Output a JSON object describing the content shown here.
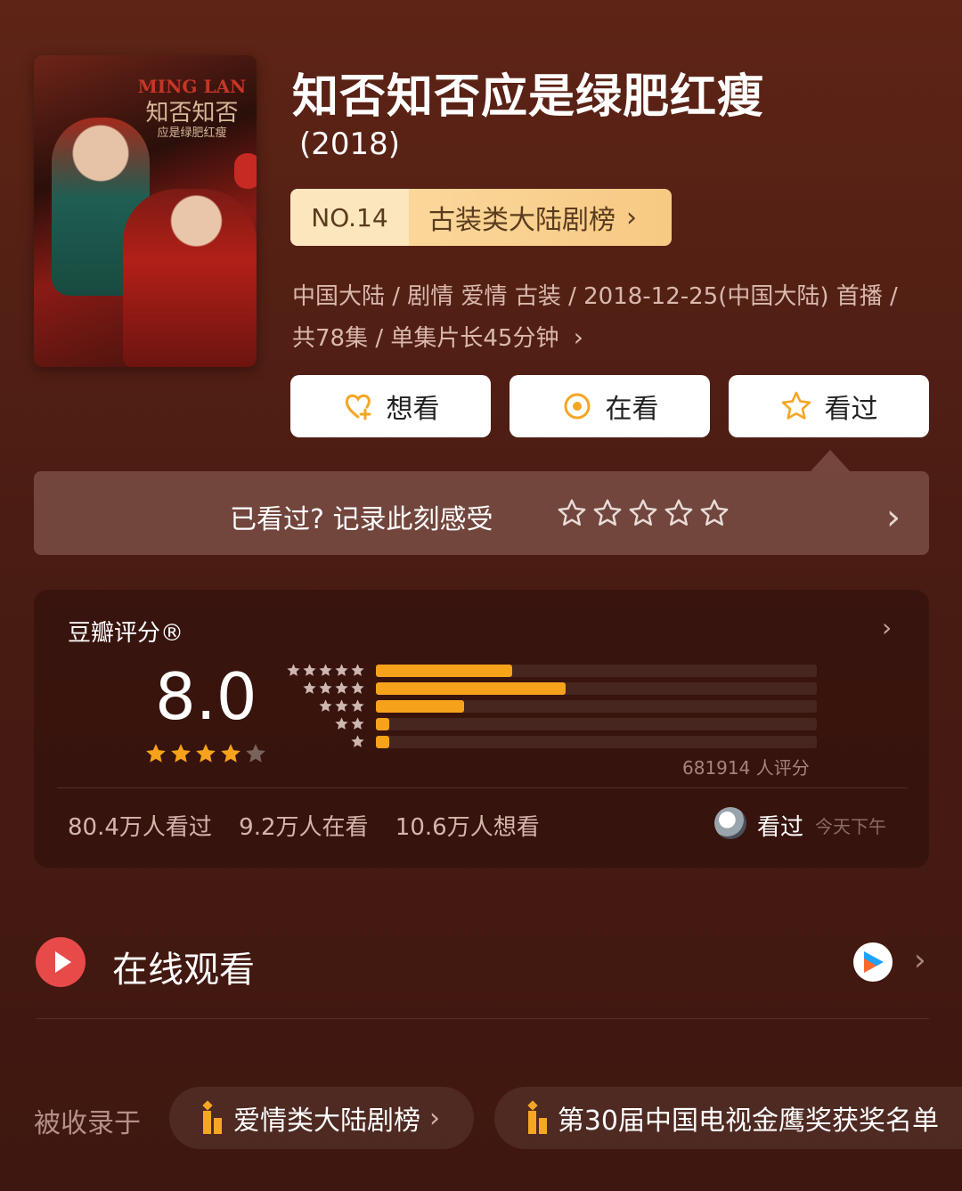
{
  "header": {
    "title": "知否知否应是绿肥红瘦",
    "year": "(2018)"
  },
  "poster": {
    "art_line1": "MING LAN",
    "art_line2": "知否知否",
    "art_line3": "应是绿肥红瘦"
  },
  "rank": {
    "number": "NO.14",
    "list_name": "古装类大陆剧榜"
  },
  "meta": {
    "line1": "中国大陆 / 剧情 爱情 古装 / 2018-12-25(中国大陆) 首播 /",
    "line2": "共78集 / 单集片长45分钟"
  },
  "actions": {
    "want": "想看",
    "watching": "在看",
    "watched": "看过"
  },
  "feel_prompt": {
    "text": "已看过? 记录此刻感受",
    "stars": 5
  },
  "rating": {
    "label": "豆瓣评分®",
    "score": "8.0",
    "stars_filled": 4,
    "stars_total": 5,
    "distribution": [
      {
        "stars": 5,
        "fraction": 0.31
      },
      {
        "stars": 4,
        "fraction": 0.43
      },
      {
        "stars": 3,
        "fraction": 0.2
      },
      {
        "stars": 2,
        "fraction": 0.03
      },
      {
        "stars": 1,
        "fraction": 0.03
      }
    ],
    "count": "681914 人评分"
  },
  "stats": {
    "watched": "80.4万人看过",
    "watching": "9.2万人在看",
    "want": "10.6万人想看"
  },
  "friend": {
    "status": "看过",
    "time": "今天下午"
  },
  "online": {
    "title": "在线观看"
  },
  "collections": {
    "label": "被收录于",
    "items": [
      "爱情类大陆剧榜",
      "第30届中国电视金鹰奖获奖名单"
    ]
  },
  "colors": {
    "accent": "#f7a21b",
    "badge_left": "#fbe6bd",
    "badge_right": "#f7c983",
    "play_red": "#e84a4a"
  }
}
